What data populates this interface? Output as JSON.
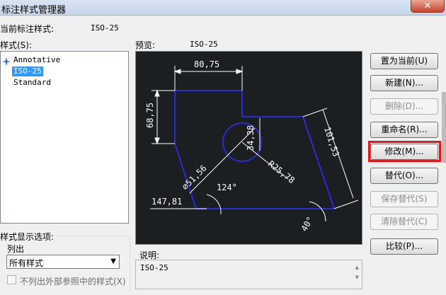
{
  "window": {
    "title": "标注样式管理器",
    "close_glyph": "✕"
  },
  "current_style": {
    "label": "当前标注样式:",
    "value": "ISO-25"
  },
  "styles": {
    "label": "样式(S):",
    "items": [
      {
        "name": "Annotative",
        "selected": false
      },
      {
        "name": "ISO-25",
        "selected": true
      },
      {
        "name": "Standard",
        "selected": false
      }
    ]
  },
  "preview": {
    "label": "预览:",
    "value": "ISO-25",
    "dimensions": {
      "top_width": "80,75",
      "left_height": "68,75",
      "slanted": "101,53",
      "diameter": "⌀51,56",
      "inner": "34,38",
      "radius": "R25,78",
      "bottom_left": "147,81",
      "angle_1": "124°",
      "angle_2": "40°"
    }
  },
  "display_options": {
    "label": "样式显示选项:",
    "list_label": "列出",
    "list_value": "所有样式",
    "checkbox_label": "不列出外部参照中的样式(X)"
  },
  "description": {
    "label": "说明:",
    "value": "ISO-25"
  },
  "buttons": {
    "set_current": "置为当前(U)",
    "new": "新建(N)...",
    "delete": "删除(D)...",
    "rename": "重命名(R)...",
    "modify": "修改(M)...",
    "override": "替代(O)...",
    "save_override": "保存替代(S)",
    "clear_override": "清除替代(C)",
    "compare": "比较(P)..."
  },
  "colors": {
    "preview_bg": "#1c1f22",
    "geometry": "#2b2bd1",
    "dimension": "#ffffff",
    "highlight": "#e6161c"
  }
}
